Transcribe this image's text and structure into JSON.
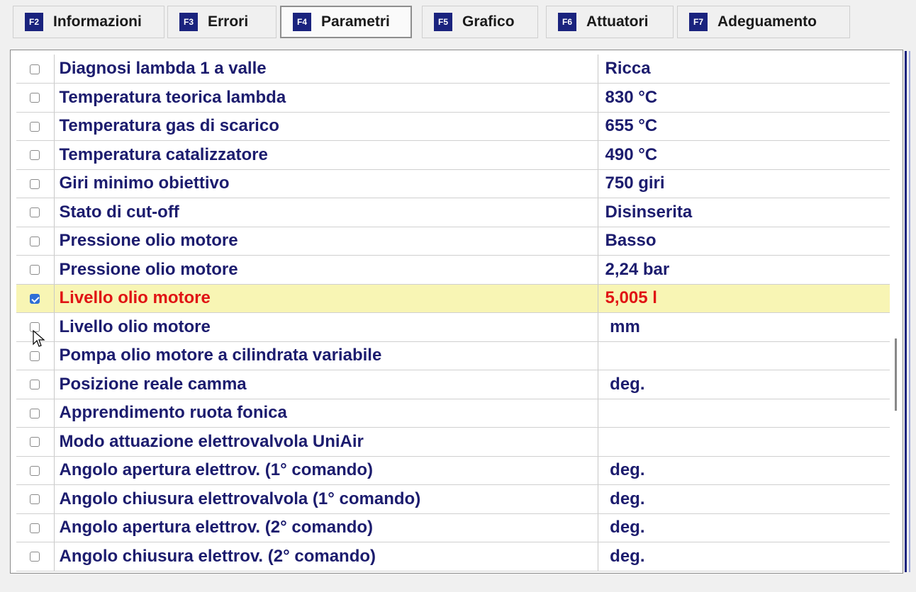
{
  "tabs": [
    {
      "key": "F2",
      "label": "Informazioni",
      "active": false
    },
    {
      "key": "F3",
      "label": "Errori",
      "active": false
    },
    {
      "key": "F4",
      "label": "Parametri",
      "active": true
    },
    {
      "key": "F5",
      "label": "Grafico",
      "active": false
    },
    {
      "key": "F6",
      "label": "Attuatori",
      "active": false
    },
    {
      "key": "F7",
      "label": "Adeguamento",
      "active": false
    }
  ],
  "rows": [
    {
      "name": "Diagnosi lambda 1 a valle",
      "value": "Ricca",
      "checked": false
    },
    {
      "name": "Temperatura teorica lambda",
      "value": "830 °C",
      "checked": false
    },
    {
      "name": "Temperatura gas di scarico",
      "value": "655 °C",
      "checked": false
    },
    {
      "name": "Temperatura catalizzatore",
      "value": "490 °C",
      "checked": false
    },
    {
      "name": "Giri minimo obiettivo",
      "value": "750 giri",
      "checked": false
    },
    {
      "name": "Stato di cut-off",
      "value": "Disinserita",
      "checked": false
    },
    {
      "name": "Pressione olio motore",
      "value": "Basso",
      "checked": false
    },
    {
      "name": "Pressione olio motore",
      "value": "2,24 bar",
      "checked": false
    },
    {
      "name": "Livello olio motore",
      "value": "5,005 l",
      "checked": true
    },
    {
      "name": "Livello olio motore",
      "value": " mm",
      "checked": false
    },
    {
      "name": "Pompa olio motore a cilindrata variabile",
      "value": "",
      "checked": false
    },
    {
      "name": "Posizione reale camma",
      "value": " deg.",
      "checked": false
    },
    {
      "name": "Apprendimento ruota fonica",
      "value": "",
      "checked": false
    },
    {
      "name": "Modo attuazione elettrovalvola UniAir",
      "value": "",
      "checked": false
    },
    {
      "name": "Angolo apertura elettrov. (1° comando)",
      "value": " deg.",
      "checked": false
    },
    {
      "name": "Angolo chiusura elettrovalvola (1° comando)",
      "value": " deg.",
      "checked": false
    },
    {
      "name": "Angolo apertura elettrov. (2° comando)",
      "value": " deg.",
      "checked": false
    },
    {
      "name": "Angolo chiusura elettrov. (2° comando)",
      "value": " deg.",
      "checked": false
    }
  ],
  "colors": {
    "accent": "#1a237e",
    "selected_row_bg": "#f8f5b4",
    "selected_text": "#e01414",
    "text": "#1c1c6e"
  }
}
